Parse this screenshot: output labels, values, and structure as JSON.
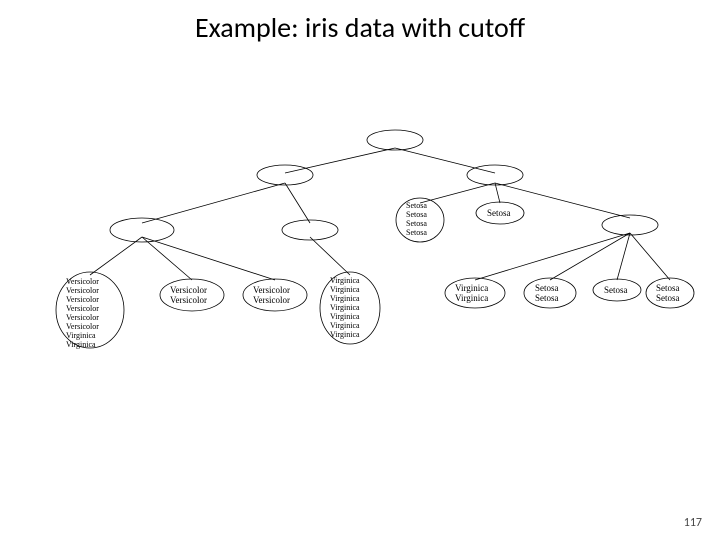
{
  "title": "Example: iris data with cutoff",
  "page_number": "117",
  "diagram": {
    "description": "Hierarchical clustering dendrogram (cut tree) of iris data showing leaf clusters labeled by species.",
    "leaves": {
      "leaf1": [
        "Versicolor",
        "Versicolor",
        "Versicolor",
        "Versicolor",
        "Versicolor",
        "Versicolor",
        "Virginica",
        "Virginica"
      ],
      "leaf2": [
        "Versicolor",
        "Versicolor"
      ],
      "leaf3": [
        "Versicolor",
        "Versicolor"
      ],
      "leaf4": [
        "Virginica",
        "Virginica",
        "Virginica",
        "Virginica",
        "Virginica",
        "Virginica",
        "Virginica"
      ],
      "leaf5": [
        "Setosa",
        "Setosa",
        "Setosa",
        "Setosa"
      ],
      "leaf6": [
        "Setosa"
      ],
      "leaf7": [
        "Virginica",
        "Virginica"
      ],
      "leaf8": [
        "Setosa",
        "Setosa"
      ],
      "leaf9": [
        "Setosa"
      ],
      "leaf10": [
        "Setosa",
        "Setosa"
      ]
    }
  }
}
